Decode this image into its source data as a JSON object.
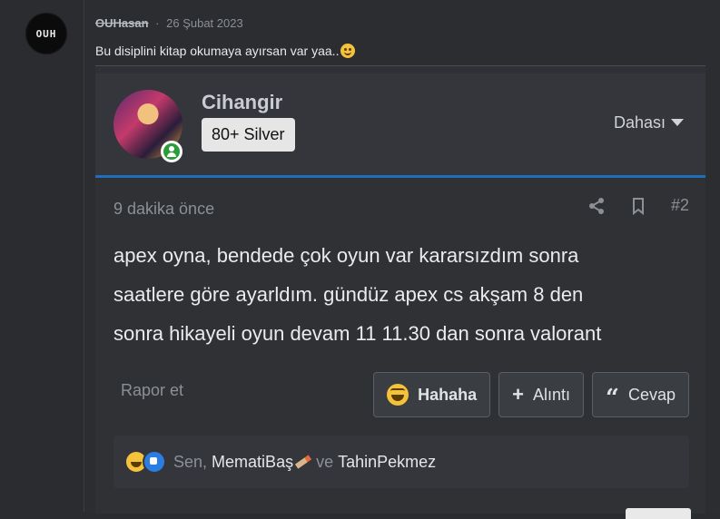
{
  "left": {
    "avatar_text": "OUH"
  },
  "comment": {
    "user": "OUHasan",
    "date": "26 Şubat 2023",
    "text": "Bu disiplini kitap okumaya ayırsan var yaa.."
  },
  "profile": {
    "username": "Cihangir",
    "rank": "80+ Silver",
    "more_label": "Dahası"
  },
  "post": {
    "time": "9 dakika önce",
    "number": "#2",
    "body_lines": [
      "apex oyna, bendede çok oyun var kararsızdım sonra",
      "saatlere göre ayarldım. gündüz apex cs akşam 8 den",
      "sonra hikayeli oyun devam 11 11.30 dan sonra valorant"
    ],
    "report": "Rapor et",
    "actions": {
      "haha": "Hahaha",
      "quote": "Alıntı",
      "reply": "Cevap"
    },
    "reactions": {
      "you": "Sen,",
      "user1": "MematiBaş",
      "and": "ve",
      "user2": "TahinPekmez"
    }
  },
  "colors": {
    "background": "#2a2c30",
    "panel": "#34363b",
    "accent_border": "#1f6fb8",
    "online": "#2e9b3b"
  },
  "icons": [
    "share-icon",
    "bookmark-icon",
    "caret-down-icon",
    "laugh-emoji-icon",
    "plus-icon",
    "quote-icon",
    "like-icon",
    "pencil-icon"
  ]
}
